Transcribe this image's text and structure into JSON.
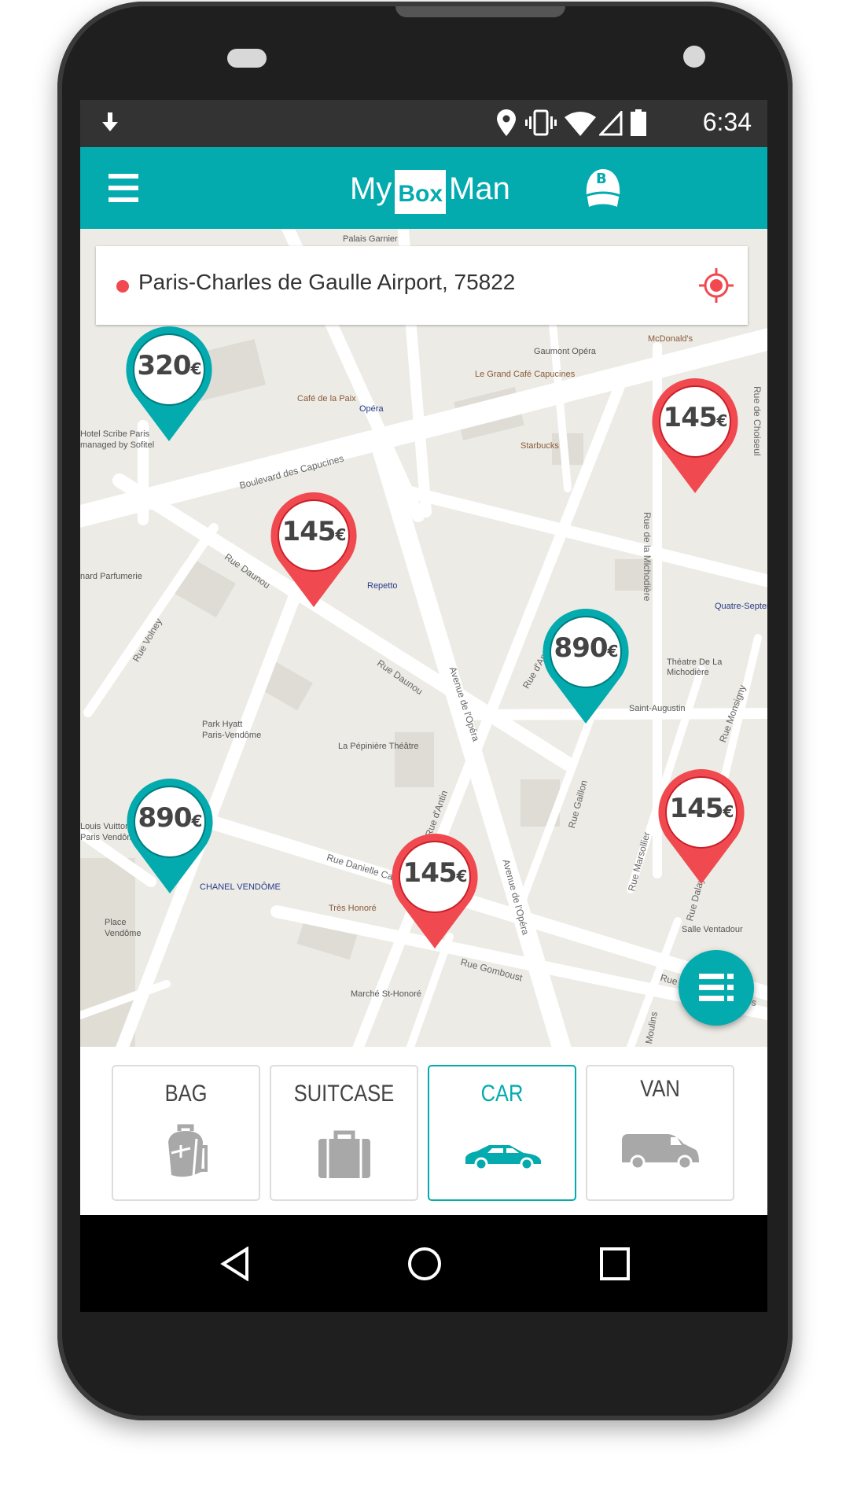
{
  "status_bar": {
    "time": "6:34",
    "icons": [
      "download-icon",
      "location-icon",
      "vibrate-icon",
      "wifi-icon",
      "signal-icon",
      "battery-icon"
    ]
  },
  "header": {
    "logo_left": "My",
    "logo_box": "Box",
    "logo_right": "Man",
    "menu_icon": "hamburger-icon",
    "profile_icon": "cap-icon",
    "profile_letter": "B"
  },
  "search": {
    "value": "Paris-Charles de Gaulle Airport, 75822",
    "locate_icon": "crosshair-icon"
  },
  "pins": [
    {
      "amount": "320",
      "currency": "€",
      "color": "#03aaae"
    },
    {
      "amount": "145",
      "currency": "€",
      "color": "#f04a50"
    },
    {
      "amount": "145",
      "currency": "€",
      "color": "#f04a50"
    },
    {
      "amount": "890",
      "currency": "€",
      "color": "#03aaae"
    },
    {
      "amount": "890",
      "currency": "€",
      "color": "#03aaae"
    },
    {
      "amount": "145",
      "currency": "€",
      "color": "#f04a50"
    },
    {
      "amount": "145",
      "currency": "€",
      "color": "#f04a50"
    }
  ],
  "map": {
    "labels": [
      "Palais Garnier",
      "McDonald's",
      "Gaumont Opéra",
      "Le Grand Café Capucines",
      "Café de la Paix",
      "Opéra",
      "Hotel Scribe Paris",
      "managed by Sofitel",
      "Starbucks",
      "Boulevard des Capucines",
      "Rue Daunou",
      "Repetto",
      "Rue de la Michodière",
      "Quatre-Septembre",
      "nard Parfumerie",
      "Rue Volney",
      "Rue Daunou",
      "Avenue de l'Opéra",
      "Rue d'Antin",
      "Théatre De La",
      "Michodière",
      "Saint-Augustin",
      "Rue Monsigny",
      "Park Hyatt",
      "Paris-Vendôme",
      "La Pépinière Théâtre",
      "Louis Vuitton",
      "Paris Vendôme",
      "CHANEL VENDÔME",
      "Rue Danielle Casanova",
      "Place",
      "Vendôme",
      "Très Honoré",
      "Rue Gaillon",
      "Avenue de l'Opéra",
      "Rue d'Antin",
      "Rue Marsollier",
      "Rue Dalayrac",
      "Salle Ventadour",
      "Rue Gomboust",
      "Marché St-Honoré",
      "Rue des Petits Champs",
      "Moulins",
      "Rue de Choiseul"
    ]
  },
  "fab": {
    "icon": "list-icon"
  },
  "vehicles": [
    {
      "label": "BAG",
      "icon": "backpack-icon",
      "selected": false
    },
    {
      "label": "SUITCASE",
      "icon": "suitcase-icon",
      "selected": false
    },
    {
      "label": "CAR",
      "icon": "car-icon",
      "selected": true
    },
    {
      "label": "VAN",
      "icon": "van-icon",
      "selected": false
    }
  ],
  "colors": {
    "accent": "#03aaae",
    "alert": "#f04a50",
    "status_bar": "#333333",
    "map_bg": "#ecebe5",
    "inactive_icon": "#a8a8a8"
  }
}
